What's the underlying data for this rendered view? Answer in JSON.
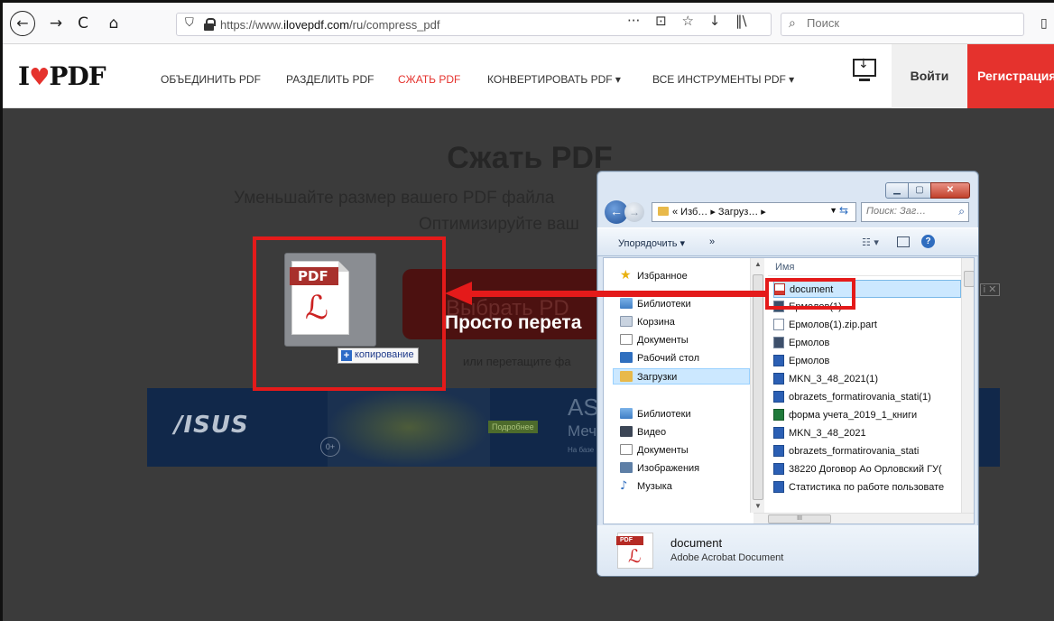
{
  "browser": {
    "url_prefix": "https://www.",
    "url_host": "ilovepdf.com",
    "url_path": "/ru/compress_pdf",
    "search_placeholder": "Поиск"
  },
  "nav": {
    "logo_left": "I",
    "logo_right": "PDF",
    "links": [
      "ОБЪЕДИНИТЬ PDF",
      "РАЗДЕЛИТЬ PDF",
      "СЖАТЬ PDF",
      "КОНВЕРТИРОВАТЬ PDF ▾",
      "ВСЕ ИНСТРУМЕНТЫ PDF ▾"
    ],
    "login": "Войти",
    "register": "Регистрация",
    "accent_color": "#e5322d"
  },
  "hero": {
    "title": "Сжать PDF",
    "subtitle_line1": "Уменьшайте размер вашего PDF файла",
    "subtitle_line2": "Оптимизируйте ваш",
    "select_button": "Выбрать PD",
    "drop_text": "Просто перета",
    "drop_hint": "или перетащите фа"
  },
  "ad": {
    "brand": "/ISUS",
    "age": "0+",
    "more": "Подробнее",
    "title": "AS",
    "subtitle": "Меч",
    "small": "На базе"
  },
  "drag": {
    "pdf_label": "PDF",
    "copy_label": "копирование"
  },
  "explorer": {
    "path": "« Изб… ▸ Загруз… ▸",
    "search_placeholder": "Поиск: Заг…",
    "organize": "Упорядочить ▾",
    "more": "»",
    "column_name": "Имя",
    "tree": [
      {
        "label": "Избранное",
        "icon": "star-icon"
      },
      {
        "label": "Библиотеки",
        "icon": "library-icon"
      },
      {
        "label": "Корзина",
        "icon": "recycle-bin-icon"
      },
      {
        "label": "Документы",
        "icon": "document-icon"
      },
      {
        "label": "Рабочий стол",
        "icon": "desktop-icon"
      },
      {
        "label": "Загрузки",
        "icon": "downloads-folder-icon"
      },
      {
        "label": "Библиотеки",
        "icon": "library-icon"
      },
      {
        "label": "Видео",
        "icon": "video-icon"
      },
      {
        "label": "Документы",
        "icon": "document-icon"
      },
      {
        "label": "Изображения",
        "icon": "images-icon"
      },
      {
        "label": "Музыка",
        "icon": "music-icon"
      }
    ],
    "files": [
      {
        "name": "document",
        "icon": "pdf-file-icon"
      },
      {
        "name": "Ермолов(1)",
        "icon": "app-file-icon"
      },
      {
        "name": "Ермолов(1).zip.part",
        "icon": "blank-file-icon"
      },
      {
        "name": "Ермолов",
        "icon": "app-file-icon"
      },
      {
        "name": "Ермолов",
        "icon": "word-file-icon"
      },
      {
        "name": "MKN_3_48_2021(1)",
        "icon": "word-file-icon"
      },
      {
        "name": "obrazets_formatirovania_stati(1)",
        "icon": "word-file-icon"
      },
      {
        "name": "форма учета_2019_1_книги",
        "icon": "excel-file-icon"
      },
      {
        "name": "MKN_3_48_2021",
        "icon": "word-file-icon"
      },
      {
        "name": "obrazets_formatirovania_stati",
        "icon": "word-file-icon"
      },
      {
        "name": "38220 Договор Ао Орловский ГУ(",
        "icon": "word-file-icon"
      },
      {
        "name": "Статистика по работе пользовате",
        "icon": "word-file-icon"
      }
    ],
    "detail_name": "document",
    "detail_type": "Adobe Acrobat Document",
    "detail_pdf_label": "PDF"
  }
}
